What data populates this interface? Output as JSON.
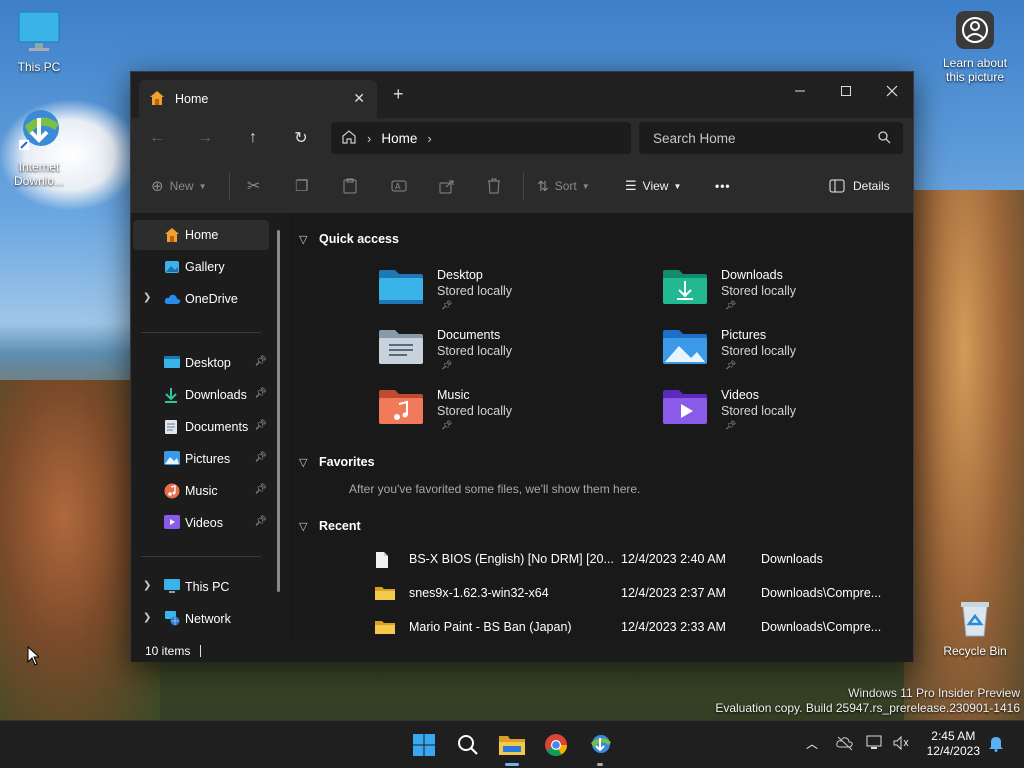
{
  "desktop": {
    "icons": {
      "this_pc": "This PC",
      "idm_line1": "Internet",
      "idm_line2": "Downlo...",
      "learn": "Learn about this picture",
      "recycle": "Recycle Bin"
    },
    "watermark_line1": "Windows 11 Pro Insider Preview",
    "watermark_line2": "Evaluation copy. Build 25947.rs_prerelease.230901-1416"
  },
  "window": {
    "tab_title": "Home",
    "new_tab": "+",
    "address_crumb": "Home",
    "search_placeholder": "Search Home",
    "toolbar": {
      "new_label": "New",
      "sort_label": "Sort",
      "view_label": "View",
      "more_label": "•••",
      "details_label": "Details"
    },
    "sidebar": {
      "home": "Home",
      "gallery": "Gallery",
      "onedrive": "OneDrive",
      "desktop": "Desktop",
      "downloads": "Downloads",
      "documents": "Documents",
      "pictures": "Pictures",
      "music": "Music",
      "videos": "Videos",
      "this_pc": "This PC",
      "network": "Network"
    },
    "sections": {
      "quick_access": "Quick access",
      "favorites": "Favorites",
      "favorites_empty": "After you've favorited some files, we'll show them here.",
      "recent": "Recent"
    },
    "quick_access": [
      {
        "name": "Desktop",
        "status": "Stored locally"
      },
      {
        "name": "Downloads",
        "status": "Stored locally"
      },
      {
        "name": "Documents",
        "status": "Stored locally"
      },
      {
        "name": "Pictures",
        "status": "Stored locally"
      },
      {
        "name": "Music",
        "status": "Stored locally"
      },
      {
        "name": "Videos",
        "status": "Stored locally"
      }
    ],
    "recent": [
      {
        "name": "BS-X BIOS (English) [No DRM] [20...",
        "date": "12/4/2023 2:40 AM",
        "location": "Downloads"
      },
      {
        "name": "snes9x-1.62.3-win32-x64",
        "date": "12/4/2023 2:37 AM",
        "location": "Downloads\\Compre..."
      },
      {
        "name": "Mario Paint - BS Ban (Japan)",
        "date": "12/4/2023 2:33 AM",
        "location": "Downloads\\Compre..."
      }
    ],
    "status": "10 items"
  },
  "taskbar": {
    "time": "2:45 AM",
    "date": "12/4/2023"
  },
  "colors": {
    "accent": "#6ab4f0",
    "window_bg": "#1c1c1c",
    "toolbar_bg": "#2b2b2b"
  }
}
